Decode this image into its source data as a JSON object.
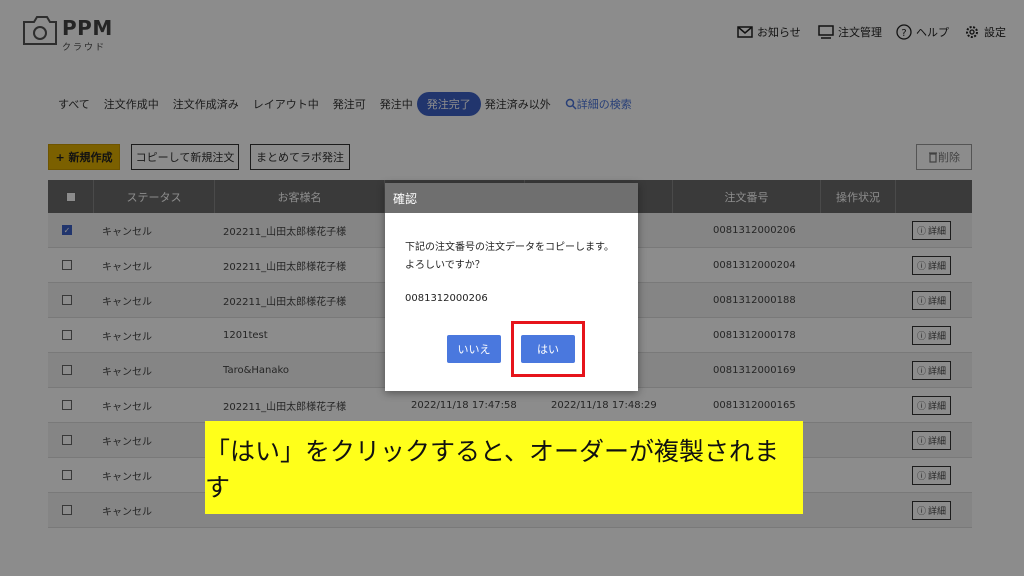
{
  "app": {
    "logo_text": "PPM",
    "logo_sub": "クラウド"
  },
  "header_nav": [
    {
      "label": "お知らせ",
      "icon": "mail-icon"
    },
    {
      "label": "注文管理",
      "icon": "monitor-icon"
    },
    {
      "label": "ヘルプ",
      "icon": "help-icon"
    },
    {
      "label": "設定",
      "icon": "gear-icon"
    }
  ],
  "tabs": [
    "すべて",
    "注文作成中",
    "注文作成済み",
    "レイアウト中",
    "発注可",
    "発注中",
    "発注完了",
    "発注済み以外"
  ],
  "active_tab": "発注完了",
  "search_link": "詳細の検索",
  "toolbar": {
    "new_label": "+ 新規作成",
    "copy_label": "コピーして新規注文",
    "bulk_label": "まとめてラボ発注",
    "delete_label": "削除"
  },
  "table": {
    "headers": [
      "",
      "ステータス",
      "お客様名",
      "",
      "",
      "注文番号",
      "操作状況",
      ""
    ],
    "detail_label": "詳細",
    "rows": [
      {
        "checked": true,
        "status": "キャンセル",
        "customer": "202211_山田太郎様花子様",
        "date1": "",
        "date2": "",
        "order_no": "0081312000206"
      },
      {
        "checked": false,
        "status": "キャンセル",
        "customer": "202211_山田太郎様花子様",
        "date1": "",
        "date2": "",
        "order_no": "0081312000204"
      },
      {
        "checked": false,
        "status": "キャンセル",
        "customer": "202211_山田太郎様花子様",
        "date1": "",
        "date2": "",
        "order_no": "0081312000188"
      },
      {
        "checked": false,
        "status": "キャンセル",
        "customer": "1201test",
        "date1": "",
        "date2": "",
        "order_no": "0081312000178"
      },
      {
        "checked": false,
        "status": "キャンセル",
        "customer": "Taro&Hanako",
        "date1": "",
        "date2": "",
        "order_no": "0081312000169"
      },
      {
        "checked": false,
        "status": "キャンセル",
        "customer": "202211_山田太郎様花子様",
        "date1": "2022/11/18 17:47:58",
        "date2": "2022/11/18 17:48:29",
        "order_no": "0081312000165"
      },
      {
        "checked": false,
        "status": "キャンセル",
        "customer": "",
        "date1": "",
        "date2": "",
        "order_no": ""
      },
      {
        "checked": false,
        "status": "キャンセル",
        "customer": "",
        "date1": "",
        "date2": "",
        "order_no": ""
      },
      {
        "checked": false,
        "status": "キャンセル",
        "customer": "",
        "date1": "",
        "date2": "",
        "order_no": ""
      }
    ]
  },
  "dialog": {
    "title": "確認",
    "message_line1": "下記の注文番号の注文データをコピーします。",
    "message_line2": "よろしいですか？",
    "order_number": "0081312000206",
    "no_label": "いいえ",
    "yes_label": "はい"
  },
  "caption": "「はい」をクリックすると、オーダーが複製されます",
  "colors": {
    "accent": "#3d61c6",
    "new_button": "#e0b000",
    "highlight": "#e6141b",
    "caption_bg": "#ffff1a"
  }
}
